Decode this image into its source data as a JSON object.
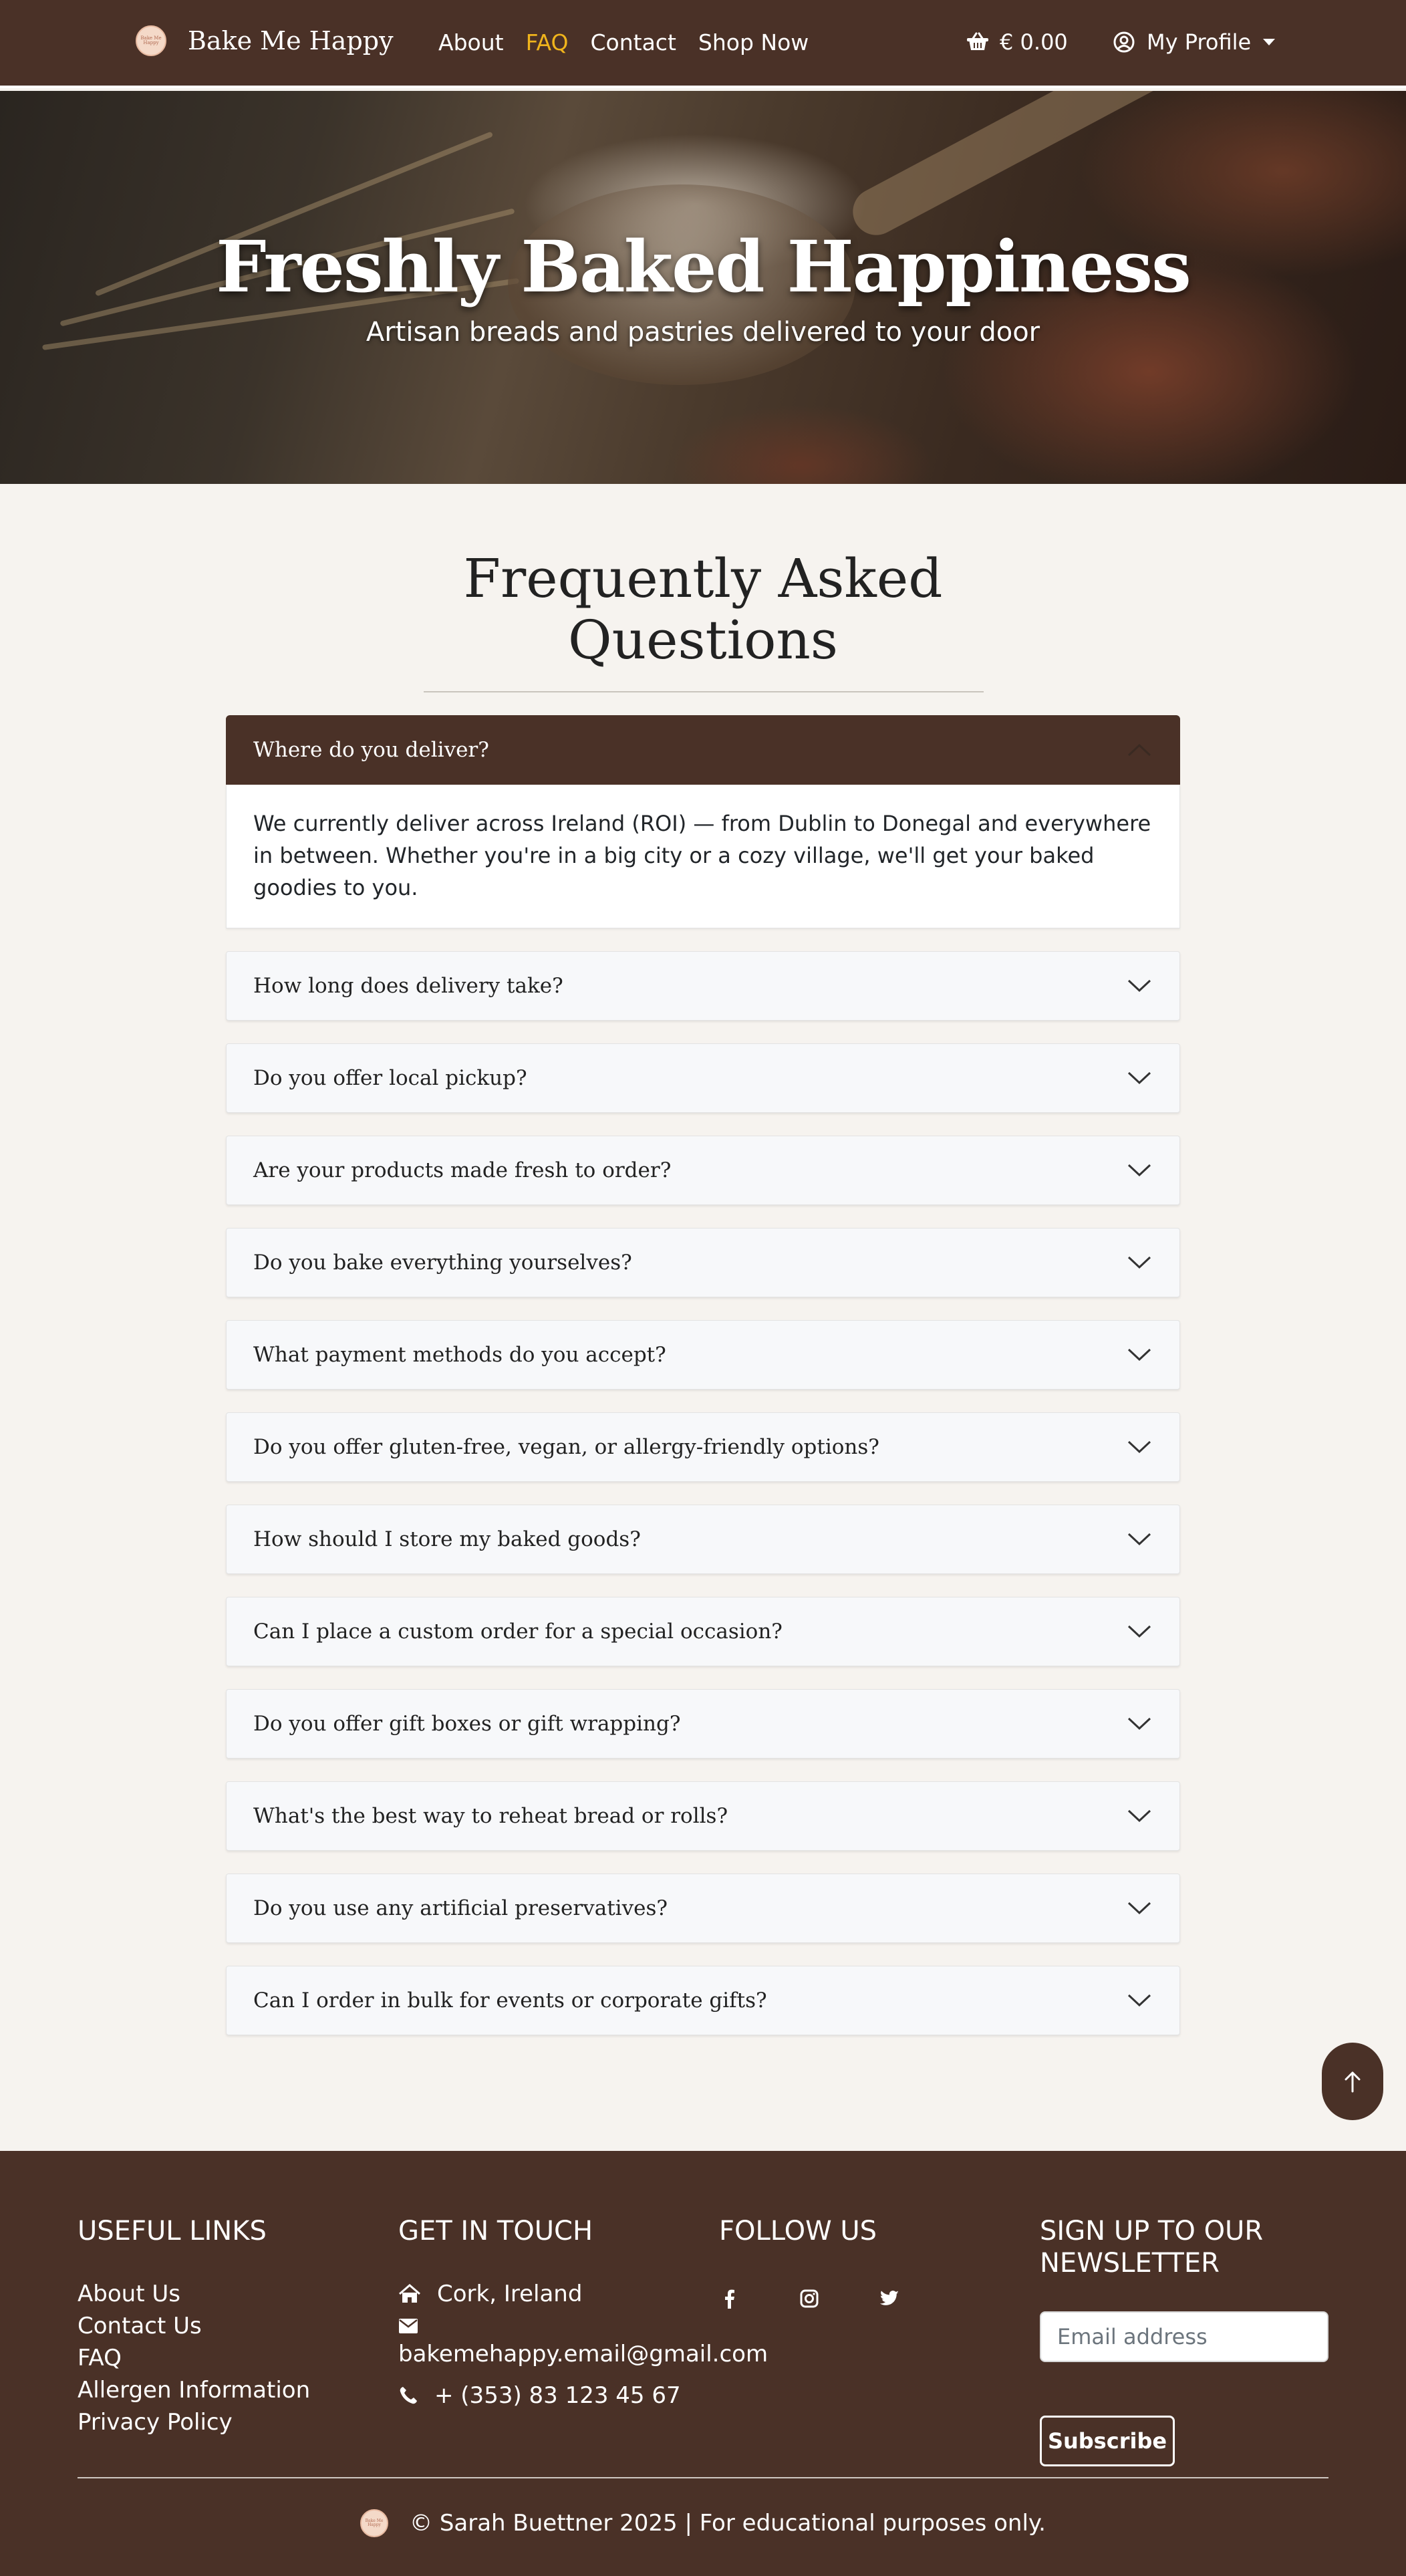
{
  "nav": {
    "brand_name": "Bake Me Happy",
    "logo_text": "Bake Me Happy",
    "links": [
      "About",
      "FAQ",
      "Contact",
      "Shop Now"
    ],
    "active_link": "FAQ",
    "cart_total": "€ 0.00",
    "profile_label": "My Profile"
  },
  "hero": {
    "title": "Freshly Baked Happiness",
    "subtitle": "Artisan breads and pastries delivered to your door"
  },
  "faq": {
    "heading_line1": "Frequently Asked",
    "heading_line2": "Questions",
    "items": [
      {
        "question": "Where do you deliver?",
        "answer": "We currently deliver across Ireland (ROI) — from Dublin to Donegal and everywhere in between. Whether you're in a big city or a cozy village, we'll get your baked goodies to you.",
        "open": true
      },
      {
        "question": "How long does delivery take?",
        "open": false
      },
      {
        "question": "Do you offer local pickup?",
        "open": false
      },
      {
        "question": "Are your products made fresh to order?",
        "open": false
      },
      {
        "question": "Do you bake everything yourselves?",
        "open": false
      },
      {
        "question": "What payment methods do you accept?",
        "open": false
      },
      {
        "question": "Do you offer gluten-free, vegan, or allergy-friendly options?",
        "open": false
      },
      {
        "question": "How should I store my baked goods?",
        "open": false
      },
      {
        "question": "Can I place a custom order for a special occasion?",
        "open": false
      },
      {
        "question": "Do you offer gift boxes or gift wrapping?",
        "open": false
      },
      {
        "question": "What's the best way to reheat bread or rolls?",
        "open": false
      },
      {
        "question": "Do you use any artificial preservatives?",
        "open": false
      },
      {
        "question": "Can I order in bulk for events or corporate gifts?",
        "open": false
      }
    ]
  },
  "footer": {
    "useful_links": {
      "heading": "USEFUL LINKS",
      "links": [
        "About Us",
        "Contact Us",
        "FAQ",
        "Allergen Information",
        "Privacy Policy"
      ]
    },
    "contact": {
      "heading": "GET IN TOUCH",
      "location": "Cork, Ireland",
      "email": "bakemehappy.email@gmail.com",
      "phone": "+ (353) 83 123 45 67"
    },
    "follow": {
      "heading": "FOLLOW US",
      "icons": [
        "facebook-icon",
        "instagram-icon",
        "twitter-icon"
      ]
    },
    "newsletter": {
      "heading_line1": "SIGN UP TO OUR",
      "heading_line2": "NEWSLETTER",
      "email_placeholder": "Email address",
      "button_label": "Subscribe"
    },
    "copyright": "© Sarah Buettner 2025 | For educational purposes only."
  },
  "colors": {
    "brand_brown": "#4a3127",
    "active_link": "#f0b41c",
    "page_background": "#f6f3ef"
  }
}
